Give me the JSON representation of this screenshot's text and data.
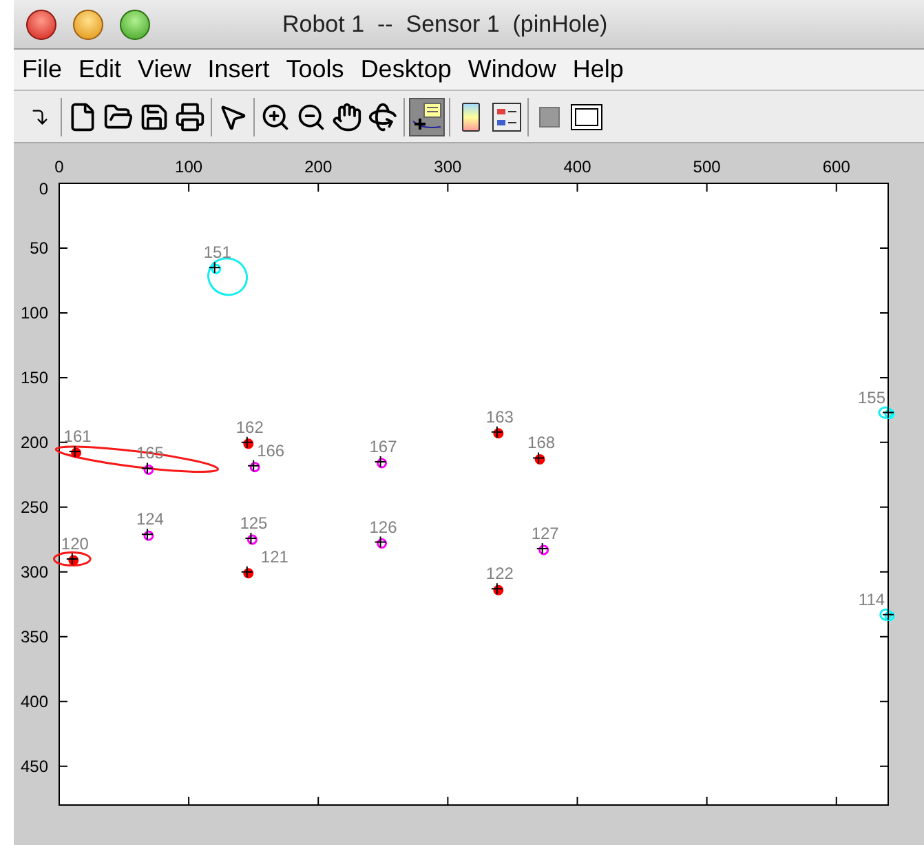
{
  "window": {
    "title": "Robot 1  --  Sensor 1  (pinHole)"
  },
  "menu": [
    "File",
    "Edit",
    "View",
    "Insert",
    "Tools",
    "Desktop",
    "Window",
    "Help"
  ],
  "toolbar_groups": [
    [
      {
        "pressed": false
      }
    ],
    [
      {
        "pressed": false
      },
      {
        "pressed": false
      },
      {
        "pressed": false
      },
      {
        "pressed": false
      }
    ],
    [
      {
        "pressed": false
      }
    ],
    [
      {
        "pressed": false
      },
      {
        "pressed": false
      },
      {
        "pressed": false
      },
      {
        "pressed": false
      }
    ],
    [
      {
        "pressed": true
      }
    ],
    [
      {
        "pressed": false
      },
      {
        "pressed": false
      }
    ],
    [
      {
        "pressed": false
      },
      {
        "pressed": false
      }
    ]
  ],
  "plot": {
    "chart_data": {
      "type": "scatter",
      "xlim": [
        0,
        640
      ],
      "ylim": [
        480,
        0
      ],
      "xticks": [
        {
          "value": 0,
          "label": "0"
        },
        {
          "value": 100,
          "label": "100"
        },
        {
          "value": 200,
          "label": "200"
        },
        {
          "value": 300,
          "label": "300"
        },
        {
          "value": 400,
          "label": "400"
        },
        {
          "value": 500,
          "label": "500"
        },
        {
          "value": 600,
          "label": "600"
        }
      ],
      "yticks": [
        {
          "value": 0,
          "label": "0"
        },
        {
          "value": 50,
          "label": "50"
        },
        {
          "value": 100,
          "label": "100"
        },
        {
          "value": 150,
          "label": "150"
        },
        {
          "value": 200,
          "label": "200"
        },
        {
          "value": 250,
          "label": "250"
        },
        {
          "value": 300,
          "label": "300"
        },
        {
          "value": 350,
          "label": "350"
        },
        {
          "value": 400,
          "label": "400"
        },
        {
          "value": 450,
          "label": "450"
        }
      ],
      "series": [
        {
          "color": "#ff0000",
          "x": [
            12,
            145,
            338,
            370,
            10,
            145,
            338
          ],
          "values": [
            207,
            200,
            192,
            212,
            290,
            300,
            313
          ]
        },
        {
          "color": "#ff00ff",
          "x": [
            68,
            150,
            248,
            68,
            148,
            248,
            373
          ],
          "values": [
            220,
            218,
            215,
            271,
            274,
            277,
            282
          ]
        },
        {
          "color": "#00ffff",
          "x": [
            120,
            640,
            640
          ],
          "values": [
            65,
            177,
            333
          ]
        }
      ],
      "annotations": [
        {
          "x": 120,
          "y": 65,
          "text": "151"
        },
        {
          "x": 12,
          "y": 207,
          "text": "161"
        },
        {
          "x": 68,
          "y": 220,
          "text": "165"
        },
        {
          "x": 145,
          "y": 200,
          "text": "162"
        },
        {
          "x": 150,
          "y": 218,
          "text": "166"
        },
        {
          "x": 248,
          "y": 215,
          "text": "167"
        },
        {
          "x": 338,
          "y": 192,
          "text": "163"
        },
        {
          "x": 370,
          "y": 212,
          "text": "168"
        },
        {
          "x": 640,
          "y": 177,
          "text": "155"
        },
        {
          "x": 10,
          "y": 290,
          "text": "120"
        },
        {
          "x": 68,
          "y": 271,
          "text": "124"
        },
        {
          "x": 148,
          "y": 274,
          "text": "125"
        },
        {
          "x": 145,
          "y": 300,
          "text": "121"
        },
        {
          "x": 248,
          "y": 277,
          "text": "126"
        },
        {
          "x": 373,
          "y": 282,
          "text": "127"
        },
        {
          "x": 338,
          "y": 313,
          "text": "122"
        },
        {
          "x": 640,
          "y": 333,
          "text": "114"
        }
      ]
    }
  }
}
